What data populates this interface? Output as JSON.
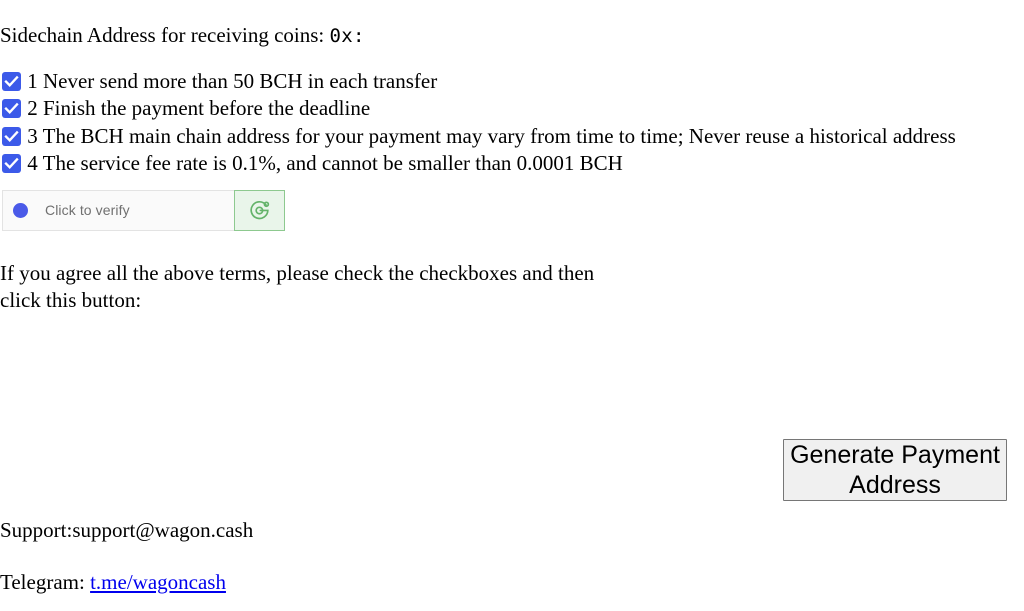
{
  "header": {
    "address_label": "Sidechain Address for receiving coins:",
    "address_prefix": "0x:"
  },
  "terms": {
    "items": [
      {
        "number": "1",
        "text": " 1 Never send more than 50 BCH in each transfer",
        "checked": true,
        "checkbox_name": "term-checkbox-1"
      },
      {
        "number": "2",
        "text": " 2 Finish the payment before the deadline",
        "checked": true,
        "checkbox_name": "term-checkbox-2"
      },
      {
        "number": "3",
        "text": " 3 The BCH main chain address for your payment may vary from time to time; Never reuse a historical address",
        "checked": true,
        "checkbox_name": "term-checkbox-3"
      },
      {
        "number": "4",
        "text": " 4 The service fee rate is 0.1%, and cannot be smaller than 0.0001 BCH",
        "checked": true,
        "checkbox_name": "term-checkbox-4"
      }
    ]
  },
  "captcha": {
    "label": "Click to verify",
    "dot_color": "#4a5ae8",
    "panel_bg": "#e9f5ea",
    "panel_border": "#8dc98f",
    "icon_name": "captcha-target-icon",
    "icon_color": "#64b36a"
  },
  "agreement": {
    "text": "If you agree all the above terms, please check the checkboxes and then click this button:"
  },
  "actions": {
    "generate_button": "Generate Payment Address"
  },
  "footer": {
    "support": "Support:support@wagon.cash",
    "telegram_label": "Telegram: ",
    "telegram_link": "t.me/wagoncash",
    "link_color": "#0000ee"
  }
}
